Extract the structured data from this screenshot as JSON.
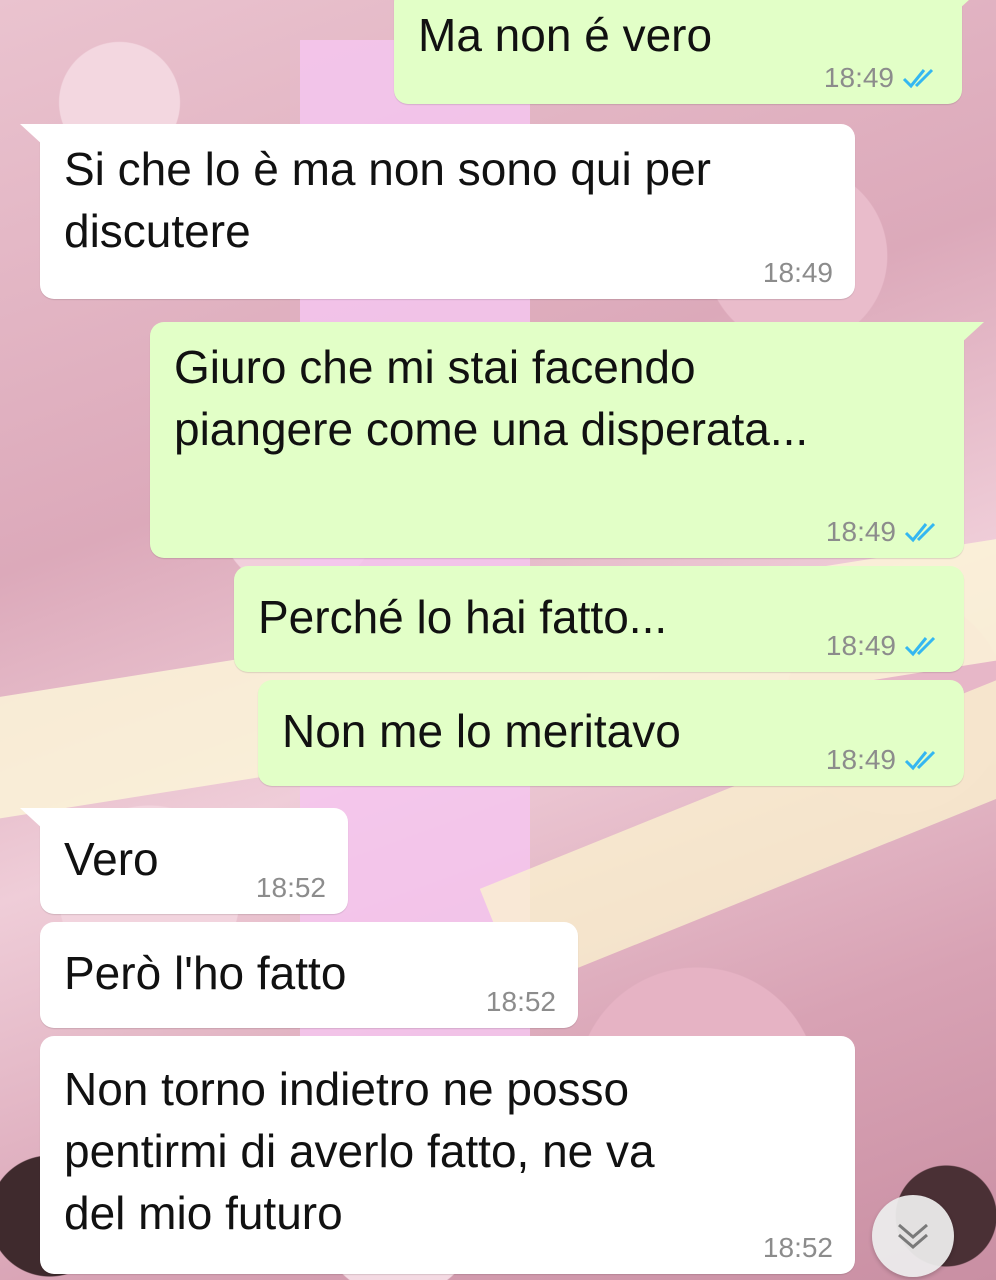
{
  "messages": [
    {
      "direction": "out",
      "text": "Ma non é vero",
      "time": "18:49",
      "status": "read"
    },
    {
      "direction": "in",
      "text": "Si che lo è ma non sono qui per\ndiscutere",
      "time": "18:49"
    },
    {
      "direction": "out",
      "text": "Giuro che mi stai facendo\npiangere come una disperata...",
      "time": "18:49",
      "status": "read"
    },
    {
      "direction": "out",
      "text": "Perché lo hai fatto...",
      "time": "18:49",
      "status": "read"
    },
    {
      "direction": "out",
      "text": "Non me lo meritavo",
      "time": "18:49",
      "status": "read"
    },
    {
      "direction": "in",
      "text": "Vero",
      "time": "18:52"
    },
    {
      "direction": "in",
      "text": "Però l'ho fatto",
      "time": "18:52"
    },
    {
      "direction": "in",
      "text": "Non torno indietro ne posso\npentirmi di averlo fatto, ne va\ndel mio futuro",
      "time": "18:52"
    }
  ],
  "colors": {
    "outgoing_bubble": "#e2ffc7",
    "incoming_bubble": "#ffffff",
    "read_ticks": "#34b7f1",
    "timestamp": "#8c8c8c"
  },
  "icons": {
    "read_receipt": "double-check-icon",
    "scroll_button": "chevron-double-down-icon"
  }
}
